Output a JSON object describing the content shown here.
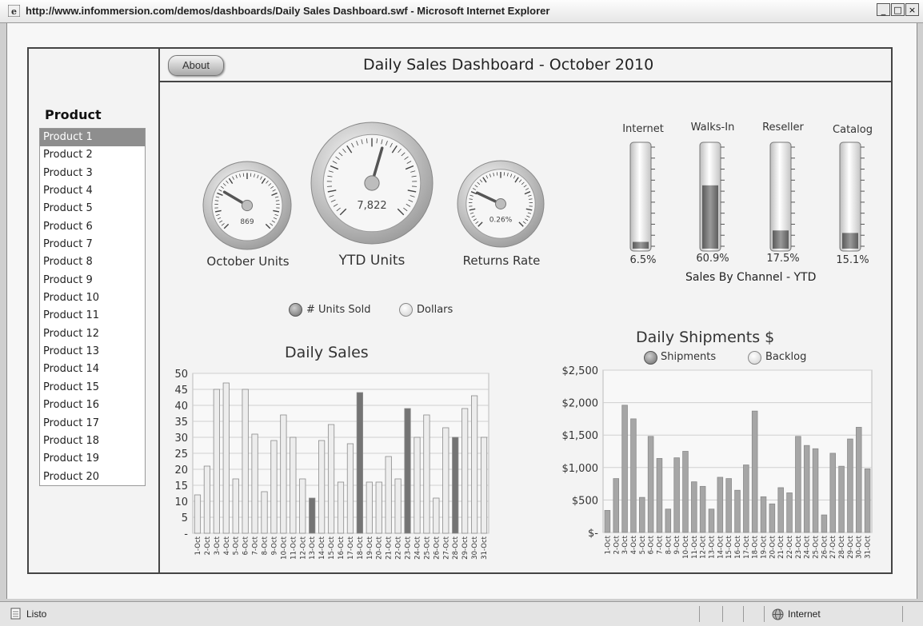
{
  "window": {
    "title": "http://www.infommersion.com/demos/dashboards/Daily Sales Dashboard.swf - Microsoft Internet Explorer",
    "min_label": "_",
    "max_label": "□",
    "close_label": "×"
  },
  "header": {
    "about_label": "About",
    "title": "Daily Sales Dashboard - October 2010"
  },
  "sidebar": {
    "heading": "Product",
    "selected_index": 0,
    "items": [
      "Product 1",
      "Product 2",
      "Product 3",
      "Product 4",
      "Product 5",
      "Product 6",
      "Product 7",
      "Product 8",
      "Product 9",
      "Product 10",
      "Product 11",
      "Product 12",
      "Product 13",
      "Product 14",
      "Product 15",
      "Product 16",
      "Product 17",
      "Product 18",
      "Product 19",
      "Product 20"
    ]
  },
  "gauges": [
    {
      "label": "October Units",
      "value_text": "869",
      "fraction": 0.28
    },
    {
      "label": "YTD Units",
      "value_text": "7,822",
      "fraction": 0.56
    },
    {
      "label": "Returns Rate",
      "value_text": "0.26%",
      "fraction": 0.26
    }
  ],
  "channels": {
    "title": "Sales By Channel - YTD",
    "items": [
      {
        "label": "Internet",
        "pct_text": "6.5%",
        "fraction": 0.065
      },
      {
        "label": "Walks-In",
        "pct_text": "60.9%",
        "fraction": 0.609
      },
      {
        "label": "Reseller",
        "pct_text": "17.5%",
        "fraction": 0.175
      },
      {
        "label": "Catalog",
        "pct_text": "15.1%",
        "fraction": 0.151
      }
    ]
  },
  "units_toggle": {
    "options": [
      {
        "label": "# Units Sold",
        "selected": true
      },
      {
        "label": "Dollars",
        "selected": false
      }
    ]
  },
  "shipments_toggle": {
    "options": [
      {
        "label": "Shipments",
        "selected": true
      },
      {
        "label": "Backlog",
        "selected": false
      }
    ]
  },
  "chart_data": [
    {
      "type": "bar",
      "title": "Daily Sales",
      "xlabel": "",
      "ylabel": "",
      "ylim": [
        0,
        50
      ],
      "yticks": [
        "-",
        "5",
        "10",
        "15",
        "20",
        "25",
        "30",
        "35",
        "40",
        "45",
        "50"
      ],
      "grid": true,
      "categories": [
        "1-Oct",
        "2-Oct",
        "3-Oct",
        "4-Oct",
        "5-Oct",
        "6-Oct",
        "7-Oct",
        "8-Oct",
        "9-Oct",
        "10-Oct",
        "11-Oct",
        "12-Oct",
        "13-Oct",
        "14-Oct",
        "15-Oct",
        "16-Oct",
        "17-Oct",
        "18-Oct",
        "19-Oct",
        "20-Oct",
        "21-Oct",
        "22-Oct",
        "23-Oct",
        "24-Oct",
        "25-Oct",
        "26-Oct",
        "27-Oct",
        "28-Oct",
        "29-Oct",
        "30-Oct",
        "31-Oct"
      ],
      "values": [
        12,
        21,
        45,
        47,
        17,
        45,
        31,
        13,
        29,
        37,
        30,
        17,
        11,
        29,
        34,
        16,
        28,
        44,
        16,
        16,
        24,
        17,
        39,
        30,
        37,
        11,
        33,
        30,
        39,
        43,
        30
      ],
      "highlighted_days": [
        "13-Oct",
        "18-Oct",
        "23-Oct",
        "28-Oct"
      ]
    },
    {
      "type": "bar",
      "title": "Daily Shipments $",
      "xlabel": "",
      "ylabel": "",
      "ylim": [
        0,
        2500
      ],
      "yticks": [
        "$-",
        "$500",
        "$1,000",
        "$1,500",
        "$2,000",
        "$2,500"
      ],
      "grid": true,
      "categories": [
        "1-Oct",
        "2-Oct",
        "3-Oct",
        "4-Oct",
        "5-Oct",
        "6-Oct",
        "7-Oct",
        "8-Oct",
        "9-Oct",
        "10-Oct",
        "11-Oct",
        "12-Oct",
        "13-Oct",
        "14-Oct",
        "15-Oct",
        "16-Oct",
        "17-Oct",
        "18-Oct",
        "19-Oct",
        "20-Oct",
        "21-Oct",
        "22-Oct",
        "23-Oct",
        "24-Oct",
        "25-Oct",
        "26-Oct",
        "27-Oct",
        "28-Oct",
        "29-Oct",
        "30-Oct",
        "31-Oct"
      ],
      "values": [
        340,
        830,
        1960,
        1750,
        540,
        1480,
        1140,
        360,
        1150,
        1250,
        780,
        710,
        360,
        850,
        830,
        650,
        1040,
        1870,
        550,
        440,
        690,
        610,
        1480,
        1340,
        1290,
        270,
        1220,
        1020,
        1440,
        1620,
        980
      ]
    }
  ],
  "colors": {
    "bar_light": "#ededed",
    "bar_dark": "#747474",
    "ship_bar": "#a6a6a6",
    "frame": "#444444"
  },
  "status": {
    "text": "Listo",
    "zone": "Internet"
  }
}
